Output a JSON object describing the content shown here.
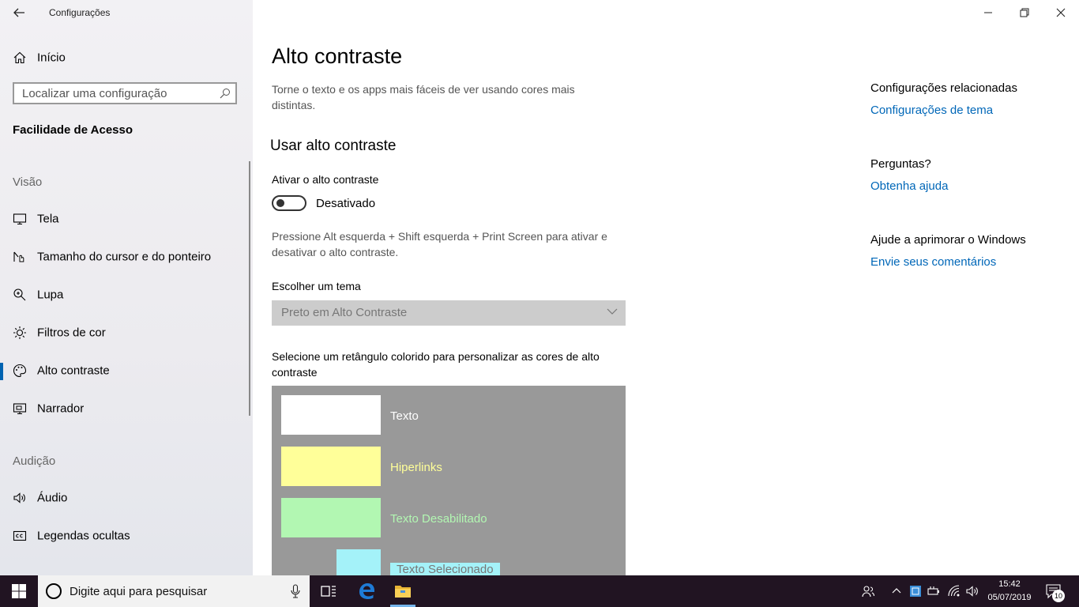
{
  "app": {
    "title": "Configurações",
    "back_icon": "back-arrow-icon"
  },
  "window": {
    "minimize": "—",
    "maximize": "❐",
    "close": "✕"
  },
  "sidebar": {
    "home_label": "Início",
    "search_placeholder": "Localizar uma configuração",
    "section_title": "Facilidade de Acesso",
    "groups": [
      {
        "label": "Visão"
      },
      {
        "label": "Audição"
      }
    ],
    "items": [
      {
        "label": "Tela",
        "icon": "monitor-icon"
      },
      {
        "label": "Tamanho do cursor e do ponteiro",
        "icon": "cursor-icon"
      },
      {
        "label": "Lupa",
        "icon": "magnifier-icon"
      },
      {
        "label": "Filtros de cor",
        "icon": "brightness-icon"
      },
      {
        "label": "Alto contraste",
        "icon": "palette-icon",
        "active": true
      },
      {
        "label": "Narrador",
        "icon": "narrator-icon"
      },
      {
        "label": "Áudio",
        "icon": "speaker-icon"
      },
      {
        "label": "Legendas ocultas",
        "icon": "closed-captions-icon"
      }
    ]
  },
  "main": {
    "title": "Alto contraste",
    "description": "Torne o texto e os apps mais fáceis de ver usando cores mais distintas.",
    "section_title": "Usar alto contraste",
    "toggle_label": "Ativar o alto contraste",
    "toggle_state": "Desativado",
    "shortcut_hint": "Pressione Alt esquerda + Shift esquerda + Print Screen para ativar e desativar o alto contraste.",
    "theme_label": "Escolher um tema",
    "theme_value": "Preto em Alto Contraste",
    "customize_label": "Selecione um retângulo colorido para personalizar as cores de alto contraste",
    "swatches": [
      {
        "label": "Texto",
        "color": "#ffffff"
      },
      {
        "label": "Hiperlinks",
        "color": "#ffff99"
      },
      {
        "label": "Texto Desabilitado",
        "color": "#b2f7b2"
      },
      {
        "label": "Texto Selecionado",
        "color": "#a4f2f9"
      }
    ]
  },
  "related": {
    "title": "Configurações relacionadas",
    "link": "Configurações de tema",
    "questions_title": "Perguntas?",
    "questions_link": "Obtenha ajuda",
    "improve_title": "Ajude a aprimorar o Windows",
    "improve_link": "Envie seus comentários"
  },
  "taskbar": {
    "search_text": "Digite aqui para pesquisar",
    "time": "15:42",
    "date": "05/07/2019",
    "notifications": "10"
  },
  "colors": {
    "accent": "#0063b1",
    "link": "#0067b8",
    "taskbar": "#211422"
  }
}
